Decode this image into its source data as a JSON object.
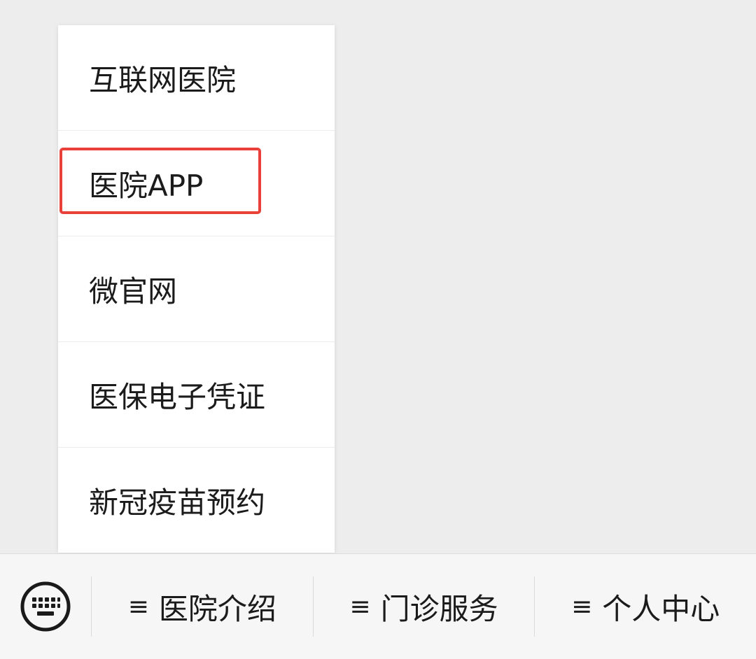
{
  "popup_menu": {
    "items": [
      {
        "label": "互联网医院"
      },
      {
        "label": "医院APP"
      },
      {
        "label": "微官网"
      },
      {
        "label": "医保电子凭证"
      },
      {
        "label": "新冠疫苗预约"
      }
    ]
  },
  "bottom_bar": {
    "keyboard_icon": "keyboard-icon",
    "tabs": [
      {
        "glyph": "≡",
        "label": "医院介绍"
      },
      {
        "glyph": "≡",
        "label": "门诊服务"
      },
      {
        "glyph": "≡",
        "label": "个人中心"
      }
    ]
  },
  "colors": {
    "background": "#ededed",
    "menu_background": "#ffffff",
    "highlight": "#e9403a",
    "bar_background": "#f6f6f6"
  }
}
